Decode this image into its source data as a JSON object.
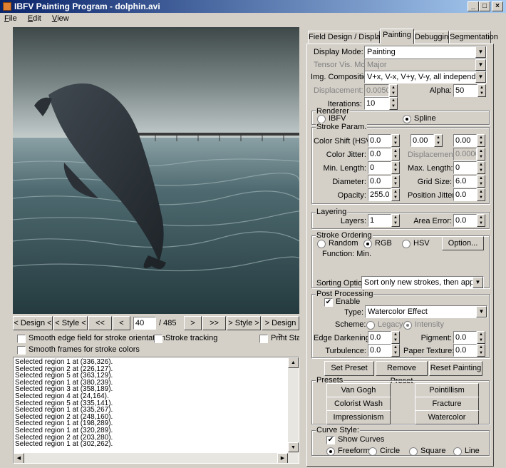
{
  "window": {
    "title": "IBFV Painting Program - dolphin.avi",
    "min": "_",
    "max": "□",
    "close": "×"
  },
  "menu": [
    {
      "label": "File",
      "key": "F",
      "rest": "ile"
    },
    {
      "label": "Edit",
      "key": "E",
      "rest": "dit"
    },
    {
      "label": "View",
      "key": "V",
      "rest": "iew"
    }
  ],
  "nav": {
    "design_prev": "< Design <",
    "style_prev": "< Style <",
    "rewind": "<<",
    "prev": "<",
    "frame": "40",
    "total": "/ 485",
    "next": ">",
    "fastforward": ">>",
    "style_next": "> Style >",
    "design_next": "> Design >"
  },
  "options": {
    "smooth_edge": "Smooth edge field for stroke orientation",
    "stroke_tracking": "Stroke tracking",
    "print_stat": "Print Stat",
    "smooth_frames": "Smooth frames for stroke colors"
  },
  "log": [
    "Selected region 1 at (336,326).",
    "Selected region 2 at (226,127).",
    "Selected region 5 at (363,129).",
    "Selected region 1 at (380,239).",
    "Selected region 3 at (358,189).",
    "Selected region 4 at (24,164).",
    "Selected region 5 at (335,141).",
    "Selected region 1 at (335,267).",
    "Selected region 2 at (248,160).",
    "Selected region 1 at (198,289).",
    "Selected region 1 at (320,289).",
    "Selected region 2 at (203,280).",
    "Selected region 1 at (302,262)."
  ],
  "tabs": [
    "Field Design / Display",
    "Painting",
    "Debugging",
    "Segmentation"
  ],
  "painting": {
    "display_mode_label": "Display Mode:",
    "display_mode": "Painting",
    "tensor_label": "Tensor Vis. Mode:",
    "tensor": "Major",
    "img_comp_label": "Img. Composition:",
    "img_comp": "V+x, V-x, V+y, V-y, all independent",
    "displacement_label": "Displacement:",
    "displacement": "0.0050",
    "alpha_label": "Alpha:",
    "alpha": "50",
    "iterations_label": "Iterations:",
    "iterations": "10",
    "renderer_title": "Renderer",
    "renderer_ibfv": "IBFV",
    "renderer_spline": "Spline",
    "stroke_param_title": "Stroke Param.",
    "color_shift_label": "Color Shift (HSV):",
    "color_shift": [
      "0.0",
      "0.00",
      "0.00"
    ],
    "color_jitter_label": "Color Jitter:",
    "color_jitter": "0.0",
    "displacement2_label": "Displacement:",
    "displacement2": "0.0000",
    "min_length_label": "Min. Length:",
    "min_length": "0",
    "max_length_label": "Max. Length:",
    "max_length": "0",
    "diameter_label": "Diameter:",
    "diameter": "0.0",
    "grid_size_label": "Grid Size:",
    "grid_size": "6.0",
    "opacity_label": "Opacity:",
    "opacity": "255.0",
    "pos_jitter_label": "Position Jitter:",
    "pos_jitter": "0.0",
    "layering_title": "Layering",
    "layers_label": "Layers:",
    "layers": "1",
    "area_error_label": "Area Error:",
    "area_error": "0.0",
    "ordering_title": "Stroke Ordering",
    "ord_random": "Random",
    "ord_rgb": "RGB",
    "ord_hsv": "HSV",
    "option_btn": "Option...",
    "function_label": "Function: Min.",
    "sorting_label": "Sorting Option:",
    "sorting": "Sort only new strokes, then append",
    "post_title": "Post Processing",
    "enable": "Enable",
    "type_label": "Type:",
    "type": "Watercolor Effect",
    "scheme_label": "Scheme:",
    "scheme_legacy": "Legacy",
    "scheme_intensity": "Intensity",
    "edge_dark_label": "Edge Darkening:",
    "edge_dark": "0.0",
    "pigment_label": "Pigment:",
    "pigment": "0.0",
    "turbulence_label": "Turbulence:",
    "turbulence": "0.0",
    "paper_label": "Paper Texture:",
    "paper": "0.0",
    "set_preset": "Set Preset",
    "remove_preset": "Remove Preset",
    "reset_painting": "Reset Painting",
    "presets_title": "Presets",
    "presets": [
      "Van Gogh",
      "Pointillism",
      "Colorist Wash",
      "Fracture",
      "Impressionism",
      "Watercolor"
    ],
    "curve_title": "Curve Style:",
    "show_curves": "Show Curves",
    "curve_freeform": "Freeform",
    "curve_circle": "Circle",
    "curve_square": "Square",
    "curve_line": "Line"
  }
}
